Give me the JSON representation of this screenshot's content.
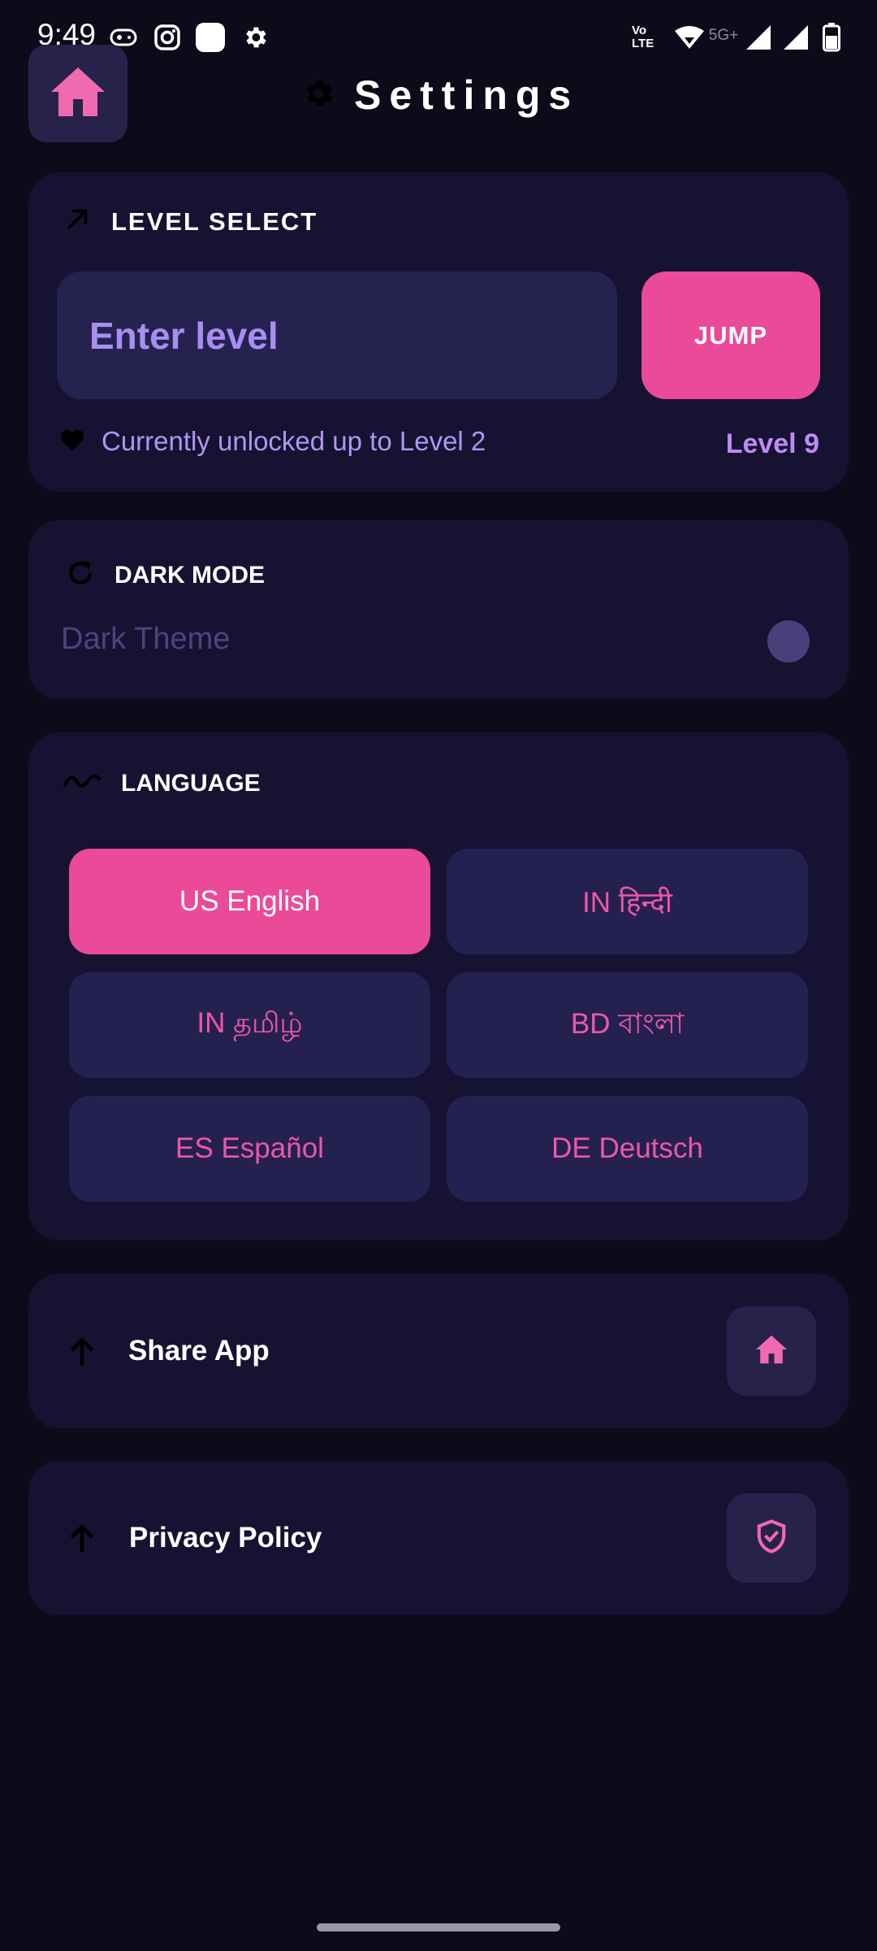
{
  "status_bar": {
    "time": "9:49",
    "network": "5G+",
    "volte": "Vo LTE",
    "icons": [
      "gamepad-icon",
      "instagram-icon",
      "app-icon",
      "settings-icon",
      "volte-icon",
      "wifi-icon",
      "signal-icon",
      "signal-icon",
      "battery-icon"
    ]
  },
  "header": {
    "title": "Settings",
    "home_icon": "home-icon",
    "title_icon": "gear-icon"
  },
  "level_select": {
    "title": "LEVEL SELECT",
    "input_placeholder": "Enter level",
    "jump_label": "JUMP",
    "unlocked_text": "Currently unlocked up to Level 2",
    "max_level": "Level 9"
  },
  "dark_mode": {
    "title": "DARK MODE",
    "theme_label": "Dark Theme",
    "enabled": false
  },
  "language": {
    "title": "LANGUAGE",
    "options": [
      {
        "label": "US English",
        "selected": true
      },
      {
        "label": "IN हिन्दी",
        "selected": false
      },
      {
        "label": "IN தமிழ்",
        "selected": false
      },
      {
        "label": "BD বাংলা",
        "selected": false
      },
      {
        "label": "ES Español",
        "selected": false
      },
      {
        "label": "DE Deutsch",
        "selected": false
      }
    ]
  },
  "share": {
    "label": "Share App",
    "icon": "home-icon"
  },
  "privacy": {
    "label": "Privacy Policy",
    "icon": "shield-check-icon"
  },
  "colors": {
    "background": "#0c0b1a",
    "card": "#151331",
    "accent_pink": "#ea4a98",
    "accent_purple": "#a98ef0"
  }
}
